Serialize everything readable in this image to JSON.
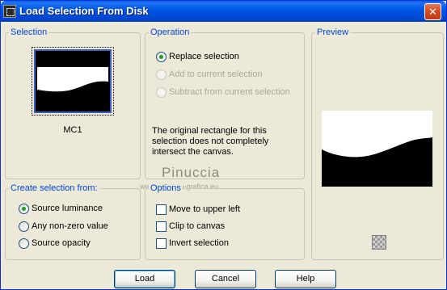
{
  "window": {
    "title": "Load Selection From Disk",
    "close_glyph": "✕"
  },
  "selection": {
    "label": "Selection",
    "thumbnail_name": "MC1"
  },
  "operation": {
    "label": "Operation",
    "options": [
      {
        "label": "Replace selection",
        "selected": true,
        "enabled": true
      },
      {
        "label": "Add to current selection",
        "selected": false,
        "enabled": false
      },
      {
        "label": "Subtract from current selection",
        "selected": false,
        "enabled": false
      }
    ],
    "message": "The original rectangle for this selection does not completely intersect the canvas."
  },
  "preview": {
    "label": "Preview"
  },
  "create_from": {
    "label": "Create selection from:",
    "options": [
      {
        "label": "Source luminance",
        "selected": true
      },
      {
        "label": "Any non-zero value",
        "selected": false
      },
      {
        "label": "Source opacity",
        "selected": false
      }
    ]
  },
  "options": {
    "label": "Options",
    "items": [
      {
        "label": "Move to upper left",
        "checked": false
      },
      {
        "label": "Clip to canvas",
        "checked": false
      },
      {
        "label": "Invert selection",
        "checked": false
      }
    ]
  },
  "watermark": {
    "name": "Pinuccia",
    "url": "www.pinuccia-grafica.eu"
  },
  "buttons": {
    "load": "Load",
    "cancel": "Cancel",
    "help": "Help"
  }
}
